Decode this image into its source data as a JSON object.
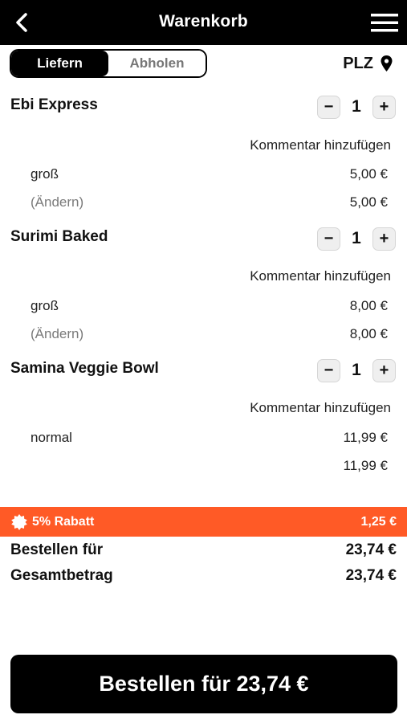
{
  "header": {
    "title": "Warenkorb",
    "back_icon": "chevron-left-icon",
    "menu_icon": "hamburger-menu-icon"
  },
  "mode_toggle": {
    "options": [
      "Liefern",
      "Abholen"
    ],
    "selected": "Liefern"
  },
  "plz": {
    "label": "PLZ",
    "icon": "location-pin-icon"
  },
  "cart": {
    "comment_label": "Kommentar hinzufügen",
    "items": [
      {
        "name": "Ebi Express",
        "quantity": "1",
        "option": "groß",
        "option_price": "5,00 €",
        "change_label": "(Ändern)",
        "total": "5,00 €"
      },
      {
        "name": "Surimi Baked",
        "quantity": "1",
        "option": "groß",
        "option_price": "8,00 €",
        "change_label": "(Ändern)",
        "total": "8,00 €"
      },
      {
        "name": "Samina Veggie Bowl",
        "quantity": "1",
        "option": "normal",
        "option_price": "11,99 €",
        "total": "11,99 €"
      }
    ],
    "minus": "−",
    "plus": "+"
  },
  "discount": {
    "label": "5% Rabatt",
    "value": "1,25 €",
    "color": "#ff5a26",
    "icon": "badge-icon"
  },
  "summary": {
    "order_for_label": "Bestellen für",
    "order_for_value": "23,74 €",
    "total_label": "Gesamtbetrag",
    "total_value": "23,74 €"
  },
  "order_button": {
    "label": "Bestellen für 23,74 €"
  }
}
